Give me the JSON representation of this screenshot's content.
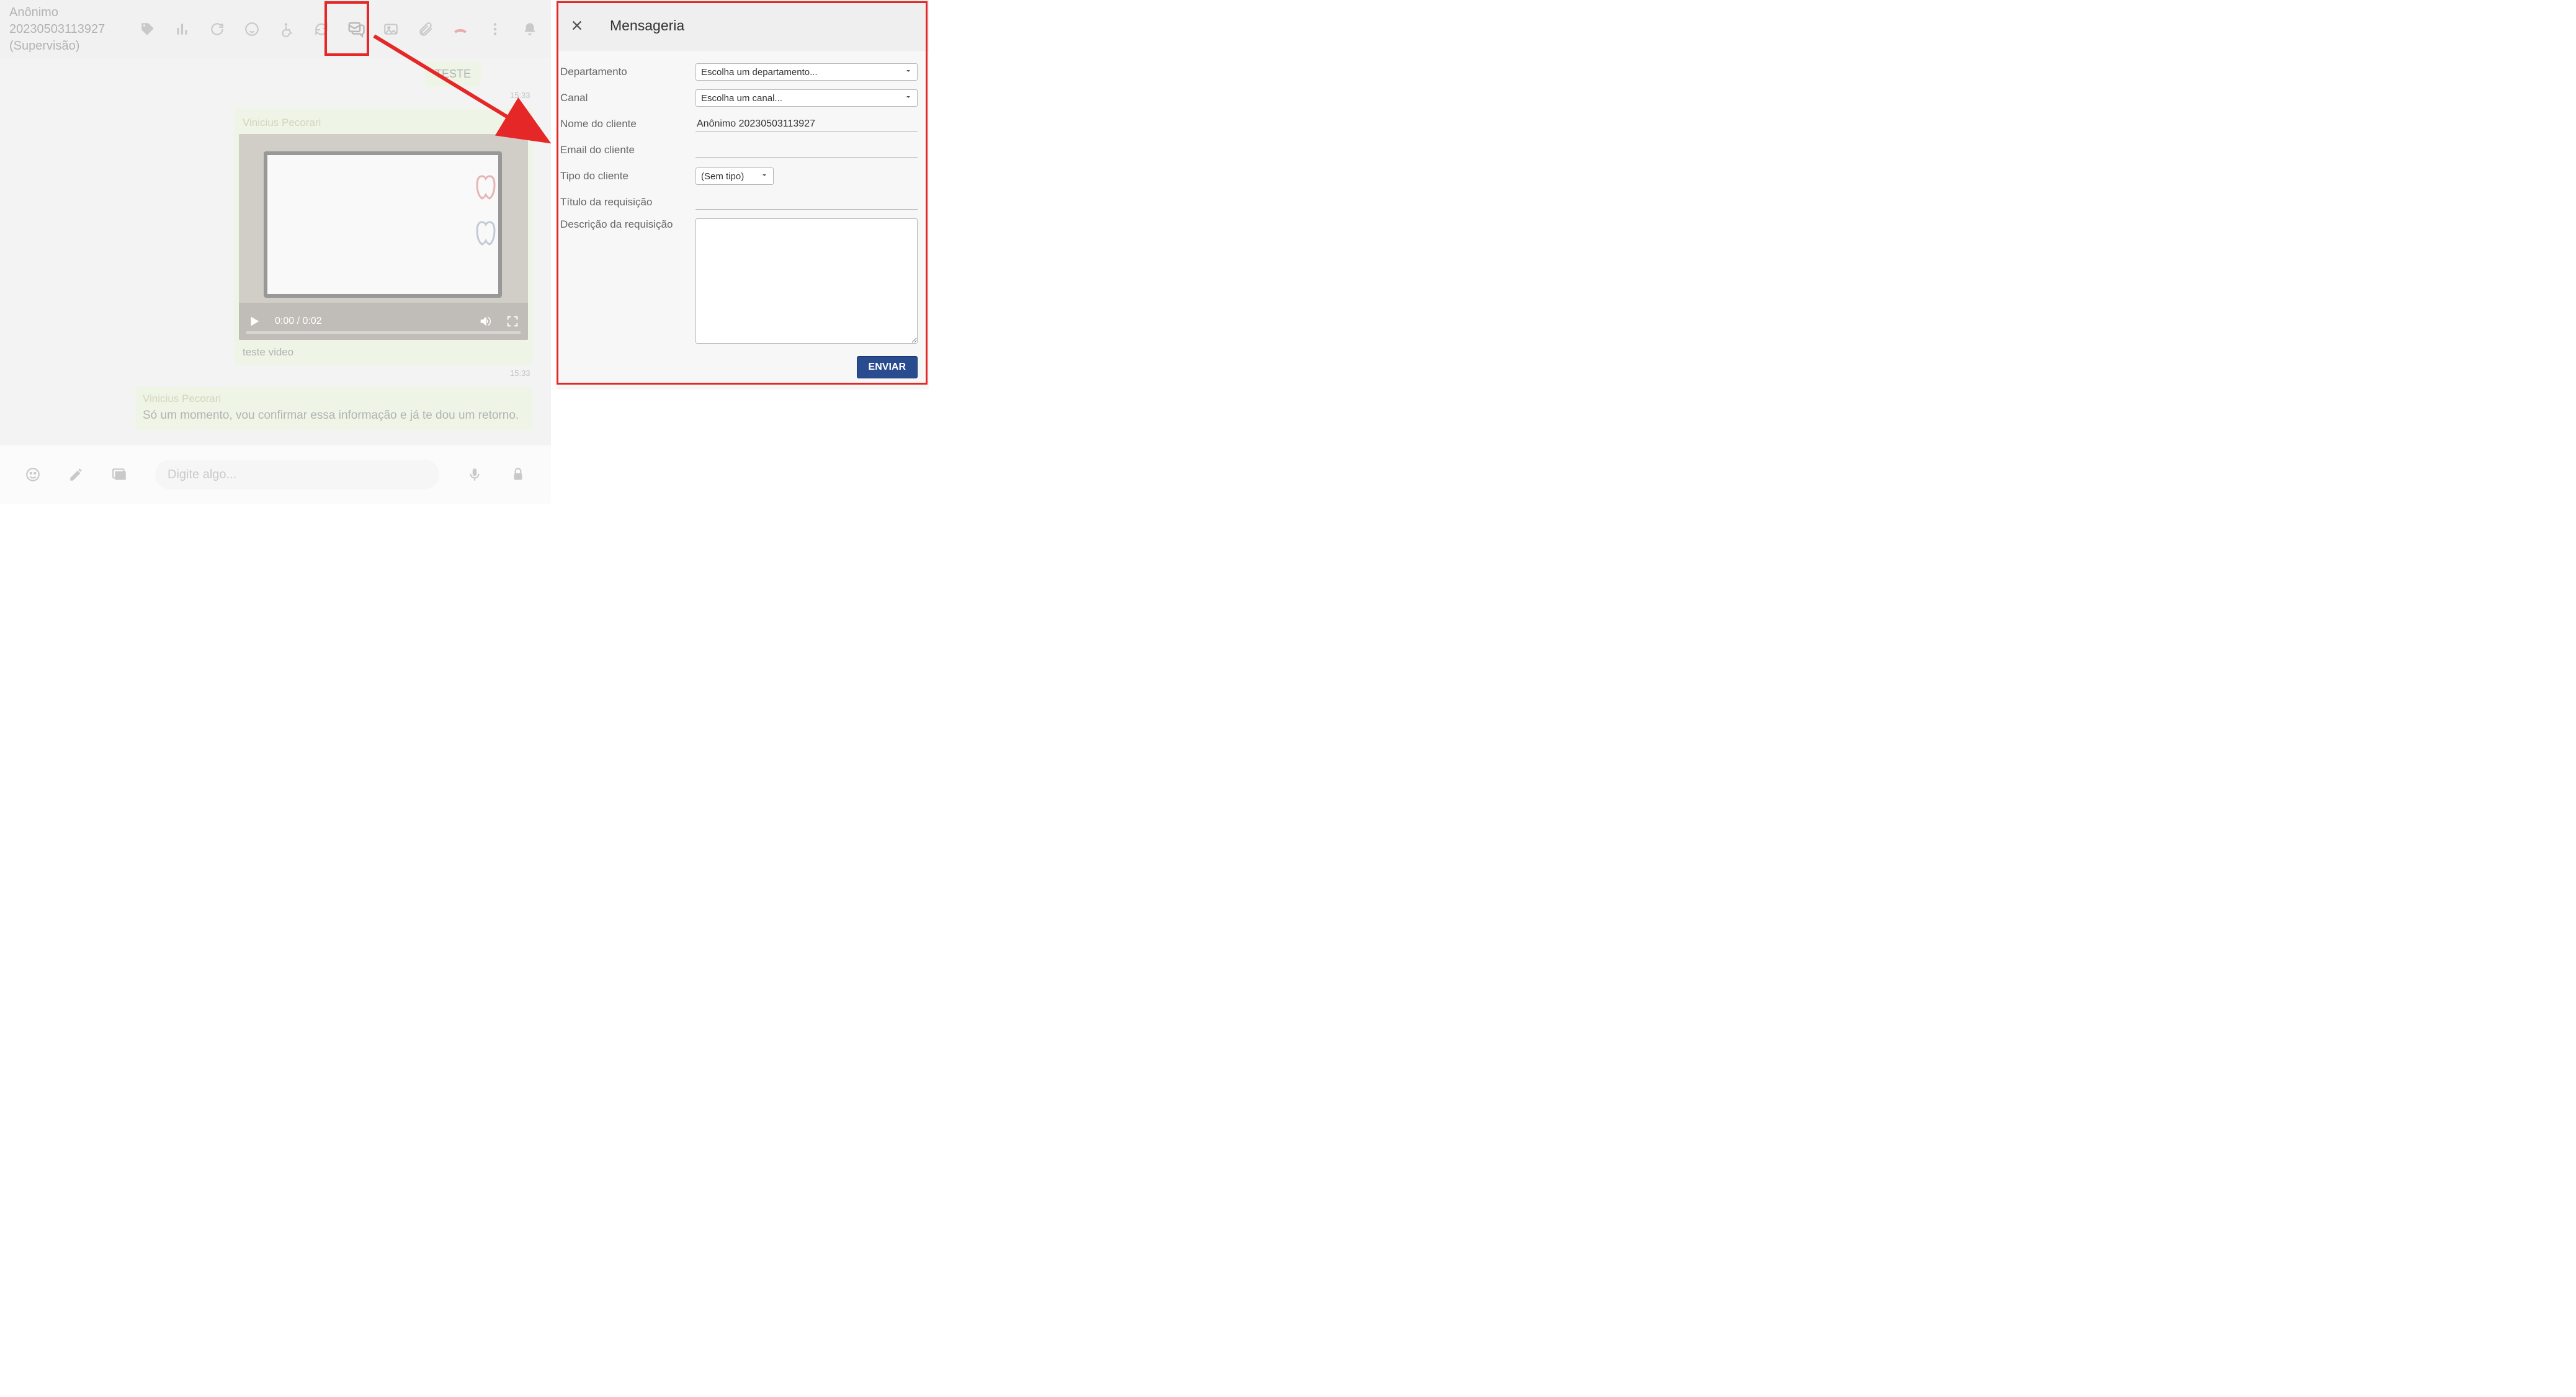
{
  "contact": {
    "name_line_1": "Anônimo",
    "name_line_2": "20230503113927",
    "role_line": "(Supervisão)"
  },
  "chat": {
    "teste_label": "TESTE",
    "msg1_time": "15:33",
    "video_sender": "Vinicius Pecorari",
    "video_time_display": "0:00 / 0:02",
    "video_caption": "teste video",
    "msg2_time": "15:33",
    "text_sender": "Vinicius Pecorari",
    "text_body": "Só um momento, vou confirmar essa informação e já te dou um retorno."
  },
  "input": {
    "placeholder": "Digite algo..."
  },
  "panel": {
    "title": "Mensageria",
    "labels": {
      "departamento": "Departamento",
      "canal": "Canal",
      "nome_cliente": "Nome do cliente",
      "email_cliente": "Email do cliente",
      "tipo_cliente": "Tipo do cliente",
      "titulo_req": "Título da requisição",
      "descricao_req": "Descrição da requisição"
    },
    "selects": {
      "departamento_placeholder": "Escolha um departamento...",
      "canal_placeholder": "Escolha um canal...",
      "tipo_placeholder": "(Sem tipo)"
    },
    "values": {
      "nome_cliente": "Anônimo 20230503113927",
      "email_cliente": "",
      "titulo_req": ""
    },
    "submit_label": "ENVIAR"
  },
  "icons": {
    "tag": "tag-icon",
    "bars": "analytics-icon",
    "refresh": "refresh-icon",
    "clock_face": "support-face-icon",
    "dashboard": "wheelchair-icon",
    "sync": "sync-icon",
    "message": "messaging-icon",
    "image": "image-icon",
    "attachment": "attachment-icon",
    "hangup": "hangup-icon",
    "more": "more-icon",
    "bell": "bell-icon",
    "emoji": "emoji-icon",
    "pencil": "pencil-icon",
    "gallery": "gallery-icon",
    "mic": "mic-icon",
    "lock": "lock-icon"
  }
}
